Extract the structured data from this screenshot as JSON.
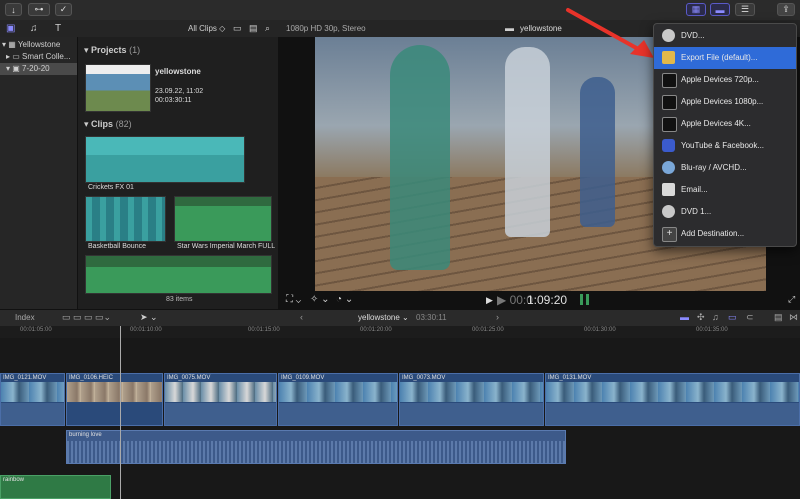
{
  "toolbar": {
    "left_icons": [
      "import-icon",
      "keyword-icon",
      "check-icon"
    ],
    "right_icons": [
      "library-toggle-icon",
      "timeline-toggle-icon",
      "inspector-toggle-icon",
      "share-icon"
    ]
  },
  "browser_header": {
    "filter_label": "All Clips ◇",
    "format_label": "1080p HD 30p, Stereo",
    "project_title": "yellowstone"
  },
  "library": {
    "items": [
      {
        "label": "Yellowstone",
        "icon": "library-icon"
      },
      {
        "label": "Smart Colle...",
        "icon": "folder-icon"
      },
      {
        "label": "7-20-20",
        "icon": "event-icon"
      }
    ]
  },
  "browser": {
    "projects_title": "Projects",
    "projects_count": "(1)",
    "project": {
      "name": "yellowstone",
      "date": "23.09.22, 11:02",
      "duration": "00:03:30:11"
    },
    "clips_title": "Clips",
    "clips_count": "(82)",
    "clips": [
      {
        "name": "Crickets FX 01"
      },
      {
        "name": "Basketball Bounce"
      },
      {
        "name": "Star Wars Imperial March FULL"
      }
    ],
    "items_count": "83 items"
  },
  "viewer": {
    "timecode": "00:01:09:20",
    "timecode_prefix": "▶ 00:0",
    "timecode_main": "1:09:20"
  },
  "share_menu": {
    "items": [
      {
        "label": "DVD...",
        "icon": "dvd-icon",
        "color": "#c8c8c8",
        "selected": false
      },
      {
        "label": "Export File (default)...",
        "icon": "export-file-icon",
        "color": "#e2b84a",
        "selected": true
      },
      {
        "label": "Apple Devices 720p...",
        "icon": "apple-device-icon",
        "color": "#111111",
        "selected": false
      },
      {
        "label": "Apple Devices 1080p...",
        "icon": "apple-device-icon",
        "color": "#111111",
        "selected": false
      },
      {
        "label": "Apple Devices 4K...",
        "icon": "apple-device-icon",
        "color": "#111111",
        "selected": false
      },
      {
        "label": "YouTube & Facebook...",
        "icon": "youtube-facebook-icon",
        "color": "#3b5bcc",
        "selected": false
      },
      {
        "label": "Blu-ray / AVCHD...",
        "icon": "bluray-icon",
        "color": "#7aa7d8",
        "selected": false
      },
      {
        "label": "Email...",
        "icon": "email-icon",
        "color": "#d9d9d9",
        "selected": false
      },
      {
        "label": "DVD 1...",
        "icon": "dvd-icon",
        "color": "#c8c8c8",
        "selected": false
      },
      {
        "label": "Add Destination...",
        "icon": "add-destination-icon",
        "color": "#666666",
        "selected": false
      }
    ]
  },
  "timeline_header": {
    "index_label": "Index",
    "project_name": "yellowstone ⌄",
    "duration": "03:30:11"
  },
  "ruler": {
    "ticks": [
      "00:01:05:00",
      "00:01:10:00",
      "00:01:15:00",
      "00:01:20:00",
      "00:01:25:00",
      "00:01:30:00",
      "00:01:35:00"
    ]
  },
  "timeline": {
    "video_clips": [
      {
        "name": "IMG_0121.MOV"
      },
      {
        "name": "IMG_0106.HEIC"
      },
      {
        "name": "IMG_0075.MOV"
      },
      {
        "name": "IMG_0109.MOV"
      },
      {
        "name": "IMG_0073.MOV"
      },
      {
        "name": "IMG_0131.MOV"
      }
    ],
    "audio_clip": {
      "name": "burning love"
    },
    "audio_clip2": {
      "name": "rainbow"
    }
  },
  "colors": {
    "accent": "#2f6bd8",
    "audio_green": "#3a9a5a",
    "audio_teal": "#4ab8b8",
    "arrow_red": "#e8332a"
  }
}
